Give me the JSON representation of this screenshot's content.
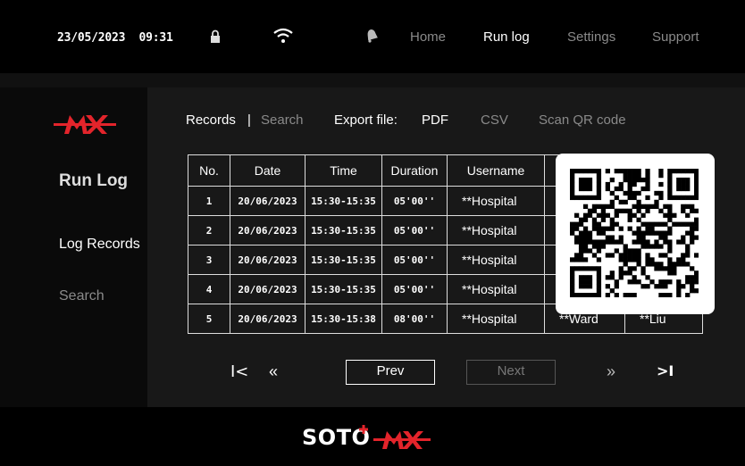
{
  "header": {
    "date": "23/05/2023",
    "time": "09:31",
    "icons": [
      "lock-icon",
      "wifi-icon",
      "bell-icon"
    ],
    "nav": [
      "Home",
      "Run log",
      "Settings",
      "Support"
    ]
  },
  "sidebar": {
    "title": "Run Log",
    "items": [
      "Log Records",
      "Search"
    ]
  },
  "toolbar": {
    "records": "Records",
    "separator": "|",
    "search": "Search",
    "export_label": "Export file:",
    "pdf": "PDF",
    "csv": "CSV",
    "scan": "Scan QR code"
  },
  "table": {
    "headers": [
      "No.",
      "Date",
      "Time",
      "Duration",
      "Username",
      "",
      ""
    ],
    "rows": [
      {
        "no": "1",
        "date": "20/06/2023",
        "time": "15:30-15:35",
        "duration": "05'00''",
        "user": "**Hospital",
        "c6": "",
        "c7": ""
      },
      {
        "no": "2",
        "date": "20/06/2023",
        "time": "15:30-15:35",
        "duration": "05'00''",
        "user": "**Hospital",
        "c6": "",
        "c7": ""
      },
      {
        "no": "3",
        "date": "20/06/2023",
        "time": "15:30-15:35",
        "duration": "05'00''",
        "user": "**Hospital",
        "c6": "",
        "c7": ""
      },
      {
        "no": "4",
        "date": "20/06/2023",
        "time": "15:30-15:35",
        "duration": "05'00''",
        "user": "**Hospital",
        "c6": "",
        "c7": ""
      },
      {
        "no": "5",
        "date": "20/06/2023",
        "time": "15:30-15:38",
        "duration": "08'00''",
        "user": "**Hospital",
        "c6": "**Ward",
        "c7": "**Liu"
      }
    ]
  },
  "pagination": {
    "first": "I<",
    "prev_fast": "«",
    "prev": "Prev",
    "next": "Next",
    "next_fast": "»",
    "last": ">I"
  },
  "footer": {
    "brand": "SOTO"
  },
  "colors": {
    "accent": "#e3242b",
    "muted": "#8a8a8a"
  }
}
